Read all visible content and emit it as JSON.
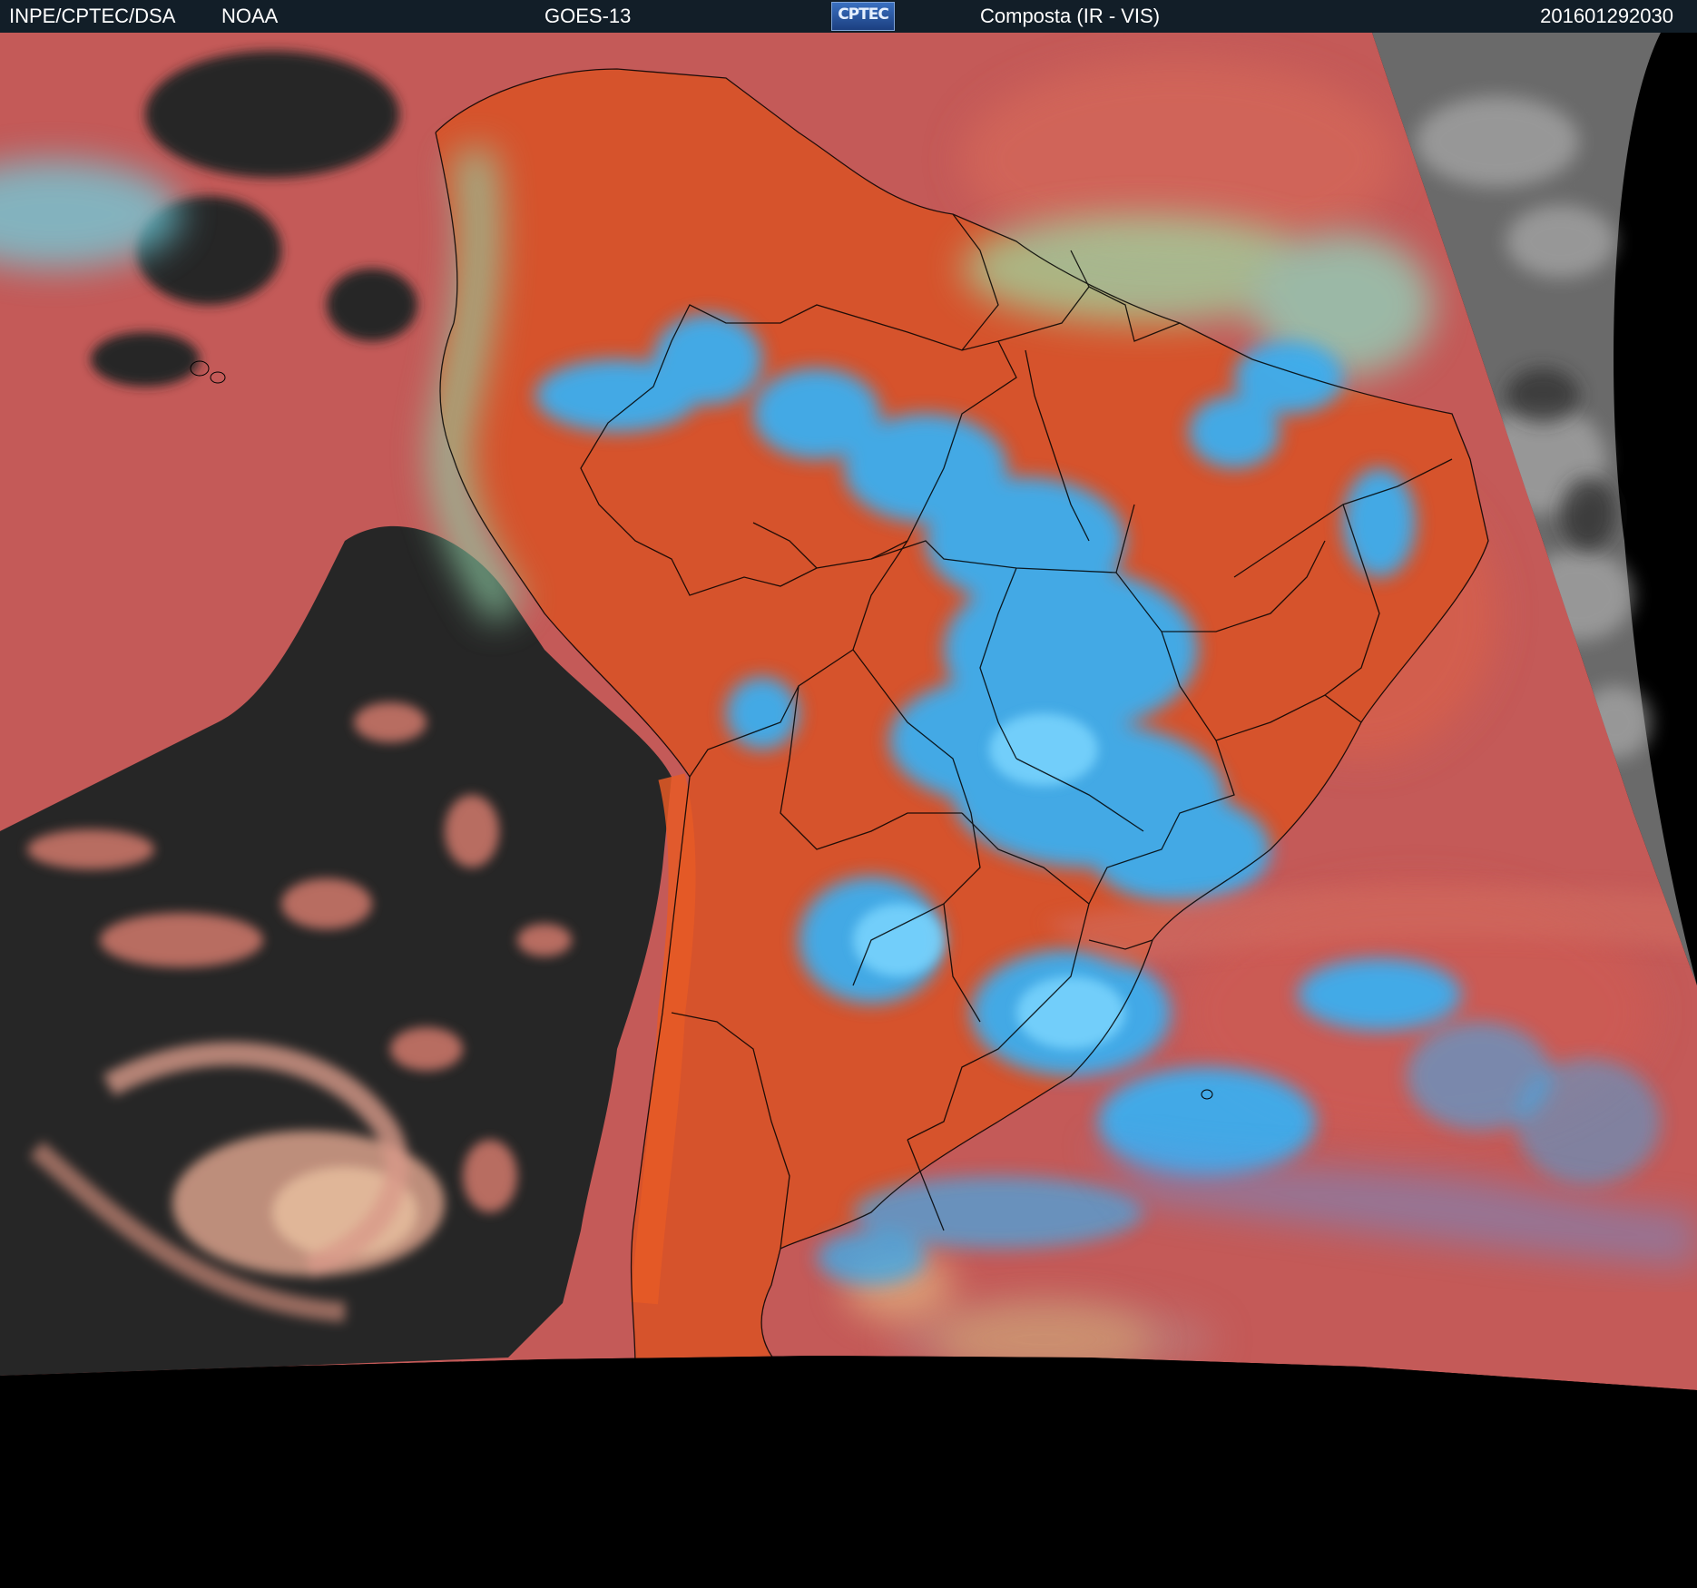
{
  "header": {
    "institution": "INPE/CPTEC/DSA",
    "agency": "NOAA",
    "satellite": "GOES-13",
    "logo_text": "CPTEC",
    "product": "Composta (IR - VIS)",
    "timestamp": "201601292030"
  },
  "image": {
    "colors": {
      "header_bg": "#121e28",
      "clear_land": "#d6532c",
      "clear_ocean": "#c45a58",
      "low_cloud_ocean": "#262626",
      "high_cloud": "#3aaef0",
      "mid_cloud": "#9ed6a0",
      "vis_disk": "#6a6a6a",
      "space": "#000000",
      "borders": "#000000"
    }
  }
}
